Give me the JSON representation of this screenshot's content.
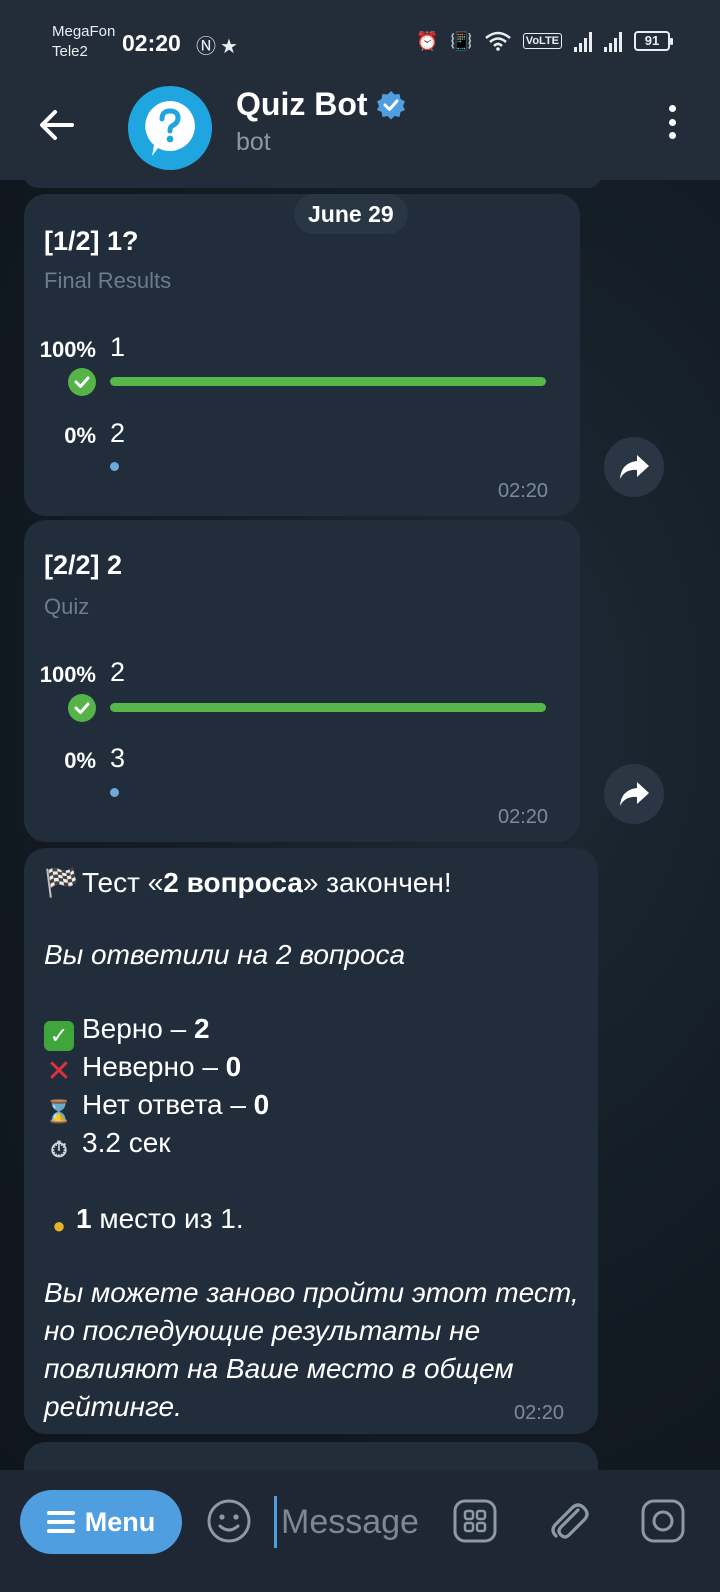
{
  "status_bar": {
    "carrier_1": "MegaFon",
    "carrier_2": "Tele2",
    "time": "02:20",
    "volte": "VoLTE",
    "battery": "91"
  },
  "header": {
    "title": "Quiz Bot",
    "subtitle": "bot",
    "verified": true
  },
  "chat": {
    "date_label": "June 29",
    "polls": [
      {
        "question": "[1/2] 1?",
        "type_label": "Final Results",
        "options": [
          {
            "percent": "100%",
            "text": "1",
            "correct": true,
            "fraction": 1.0
          },
          {
            "percent": "0%",
            "text": "2",
            "correct": false,
            "fraction": 0.0
          }
        ],
        "time": "02:20"
      },
      {
        "question": "[2/2] 2",
        "type_label": "Quiz",
        "options": [
          {
            "percent": "100%",
            "text": "2",
            "correct": true,
            "fraction": 1.0
          },
          {
            "percent": "0%",
            "text": "3",
            "correct": false,
            "fraction": 0.0
          }
        ],
        "time": "02:20"
      }
    ],
    "result_message": {
      "title_prefix": "Тест «",
      "test_name": "2 вопроса",
      "title_suffix": "» закончен!",
      "answered": "Вы ответили на 2 вопроса",
      "correct_label": "Верно – ",
      "correct_value": "2",
      "wrong_label": "Неверно – ",
      "wrong_value": "0",
      "no_answer_label": "Нет ответа – ",
      "no_answer_value": "0",
      "duration": "3.2 сек",
      "place_value": "1",
      "place_text": " место из 1.",
      "note_line_1": "Вы можете заново пройти этот тест,",
      "note_line_2": "но последующие результаты не",
      "note_line_3": "повлияют на Ваше место в общем",
      "note_line_4": "рейтинге.",
      "time": "02:20"
    }
  },
  "input_bar": {
    "menu_label": "Menu",
    "placeholder": "Message"
  },
  "colors": {
    "accent": "#4e9ee0",
    "correct_green": "#56b84a",
    "bubble_bg": "#212d3b",
    "header_bg": "#232d3a"
  }
}
